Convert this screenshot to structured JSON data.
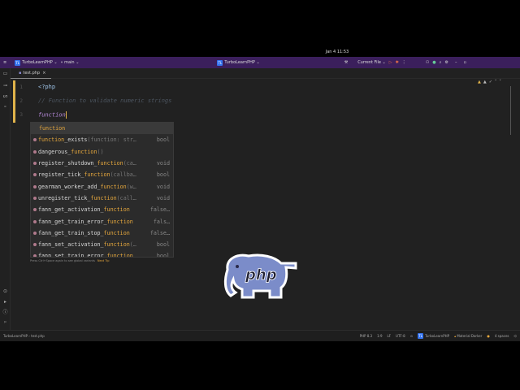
{
  "system": {
    "clock": "Jan 4  11:53"
  },
  "titlebar": {
    "project": "TurboLearnPHP",
    "project_badge": "TL",
    "branch": "main",
    "center_project": "TurboLearnPHP",
    "run_config": "Current File"
  },
  "tabs": [
    {
      "label": "test.php"
    }
  ],
  "editor": {
    "line_numbers": [
      "1",
      "2",
      "3"
    ],
    "lines": [
      "<?php",
      "// Function to validate numeric strings",
      "function"
    ]
  },
  "completion": {
    "items": [
      {
        "pre": "",
        "hl": "function",
        "post": "",
        "sig": "",
        "type": ""
      },
      {
        "pre": "",
        "hl": "function",
        "post": "_exists",
        "sig": "(function: str…",
        "type": "bool"
      },
      {
        "pre": "dangerous_",
        "hl": "function",
        "post": "",
        "sig": "()",
        "type": ""
      },
      {
        "pre": "register_shutdown_",
        "hl": "function",
        "post": "",
        "sig": "(ca…",
        "type": "void"
      },
      {
        "pre": "register_tick_",
        "hl": "function",
        "post": "",
        "sig": "(callba…",
        "type": "bool"
      },
      {
        "pre": "gearman_worker_add_",
        "hl": "function",
        "post": "",
        "sig": "(w…",
        "type": "void"
      },
      {
        "pre": "unregister_tick_",
        "hl": "function",
        "post": "",
        "sig": "(call…",
        "type": "void"
      },
      {
        "pre": "fann_get_activation_",
        "hl": "function",
        "post": "",
        "sig": "",
        "type": "false…"
      },
      {
        "pre": "fann_get_train_error_",
        "hl": "function",
        "post": "",
        "sig": "",
        "type": "fals…"
      },
      {
        "pre": "fann_get_train_stop_",
        "hl": "function",
        "post": "",
        "sig": "",
        "type": "false…"
      },
      {
        "pre": "fann_set_activation_",
        "hl": "function",
        "post": "",
        "sig": "(…",
        "type": "bool"
      },
      {
        "pre": "fann_set_train_error_",
        "hl": "function",
        "post": "",
        "sig": "",
        "type": "bool"
      }
    ],
    "hint": "Press Ctrl+Space again to see global variants",
    "hint_link": "Next Tip"
  },
  "status": {
    "breadcrumb_project": "TurboLearnPHP",
    "breadcrumb_file": "test.php",
    "php": "PHP 8.3",
    "position": "1:9",
    "line_sep": "LF",
    "encoding": "UTF-8",
    "project": "TurboLearnPHP",
    "theme": "Material Darker",
    "indent": "4 spaces"
  },
  "logo": {
    "text": "php"
  }
}
